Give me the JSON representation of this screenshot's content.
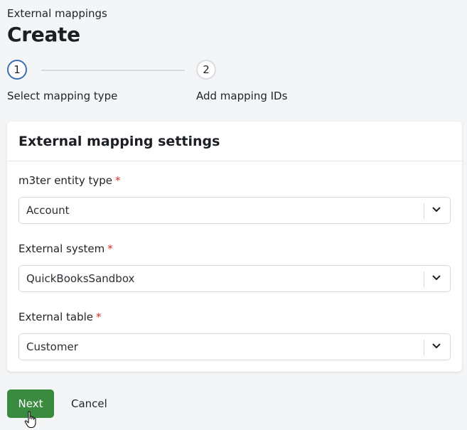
{
  "header": {
    "breadcrumb": "External mappings",
    "title": "Create"
  },
  "stepper": {
    "steps": [
      {
        "number": "1",
        "label": "Select mapping type",
        "state": "active"
      },
      {
        "number": "2",
        "label": "Add mapping IDs",
        "state": "inactive"
      }
    ]
  },
  "card": {
    "title": "External mapping settings",
    "fields": [
      {
        "label": "m3ter entity type",
        "required_mark": "*",
        "value": "Account"
      },
      {
        "label": "External system",
        "required_mark": "*",
        "value": "QuickBooksSandbox"
      },
      {
        "label": "External table",
        "required_mark": "*",
        "value": "Customer"
      }
    ]
  },
  "actions": {
    "next_label": "Next",
    "cancel_label": "Cancel"
  },
  "colors": {
    "primary_button": "#3a8a3f",
    "active_step_border": "#3b6fb6",
    "required": "#d62d2d"
  },
  "icons": {
    "select_chevron": "chevron-down-icon",
    "pointer": "hand-pointer-cursor-icon"
  }
}
